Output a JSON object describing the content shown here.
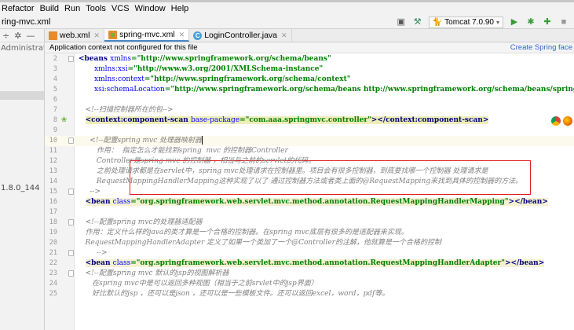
{
  "menu": [
    "Refactor",
    "Build",
    "Run",
    "Tools",
    "VCS",
    "Window",
    "Help"
  ],
  "breadcrumb": "ring-mvc.xml",
  "toolbar": {
    "run_config": "Tomcat 7.0.90"
  },
  "project": {
    "path": "Administrator\\Ic",
    "jdk": "1.8.0_144"
  },
  "tabs": [
    {
      "label": "web.xml",
      "icon": "xml-file-icon"
    },
    {
      "label": "spring-mvc.xml",
      "icon": "spring-xml-icon",
      "active": true
    },
    {
      "label": "LoginController.java",
      "icon": "java-class-icon"
    }
  ],
  "notification": {
    "message": "Application context not configured for this file",
    "action": "Create Spring face"
  },
  "editor": {
    "lines": [
      {
        "n": "2",
        "seg": [
          [
            "<beans ",
            "tag"
          ],
          [
            "xmlns",
            "attr"
          ],
          [
            "=\"http://www.springframework.org/schema/beans\"",
            "val"
          ]
        ]
      },
      {
        "n": "3",
        "seg": [
          [
            "       xmlns:xsi",
            "attr"
          ],
          [
            "=\"http://www.w3.org/2001/XMLSchema-instance\"",
            "val"
          ]
        ]
      },
      {
        "n": "4",
        "seg": [
          [
            "       xmlns:context",
            "attr"
          ],
          [
            "=\"http://www.springframework.org/schema/context\"",
            "val"
          ]
        ]
      },
      {
        "n": "5",
        "seg": [
          [
            "       xsi:schemaLocation",
            "attr"
          ],
          [
            "=\"http://www.springframework.org/schema/beans http://www.springframework.org/schema/beans/spring-beans.xs",
            "val"
          ]
        ]
      },
      {
        "n": "6",
        "seg": []
      },
      {
        "n": "7",
        "seg": [
          [
            "   <!--扫描控制器所在的包-->",
            "cmt"
          ]
        ]
      },
      {
        "n": "8",
        "seg": [
          [
            "   ",
            ""
          ],
          [
            "<context:component-scan ",
            "tag bgy"
          ],
          [
            "base-package",
            "attr bgy"
          ],
          [
            "=\"com.aaa.springmvc.controller\"",
            "val bgy"
          ],
          [
            "></context:component-scan>",
            "tag bgy"
          ]
        ]
      },
      {
        "n": "9",
        "seg": []
      },
      {
        "n": "10",
        "seg": [
          [
            "     <!--配置spring mvc 处理器映射器",
            "cmt"
          ]
        ]
      },
      {
        "n": "11",
        "seg": [
          [
            "        作用：  指定怎么才能找到spring  mvc 的控制器Controller",
            "cmt"
          ]
        ]
      },
      {
        "n": "12",
        "seg": [
          [
            "        Controller是spring mvc 的控制器 ，相当与之前的servlet的代码。",
            "cmt"
          ]
        ]
      },
      {
        "n": "13",
        "seg": [
          [
            "        之前处理请求都是在servlet中，spring mvc处理请求在控制器里。项目会有很多控制器，到底要找哪一个控制器 处理请求是",
            "cmt"
          ]
        ]
      },
      {
        "n": "14",
        "seg": [
          [
            "        RequestMappingHandlerMapping这种实现了以了 通过控制器方法或者类上面的@RequestMapping来找到具体的控制器的方法。",
            "cmt"
          ]
        ]
      },
      {
        "n": "15",
        "seg": [
          [
            "     -->",
            "cmt"
          ]
        ]
      },
      {
        "n": "16",
        "seg": [
          [
            "   ",
            ""
          ],
          [
            "<bean ",
            "tag hl"
          ],
          [
            "class",
            "attr hl"
          ],
          [
            "=\"org.springframework.web.servlet.mvc.method.annotation.RequestMappingHandlerMapping\"",
            "val hl"
          ],
          [
            "></bean>",
            "tag hl"
          ]
        ]
      },
      {
        "n": "17",
        "seg": []
      },
      {
        "n": "18",
        "seg": [
          [
            "   <!--配置spring mvc的处理器适配器",
            "cmt"
          ]
        ]
      },
      {
        "n": "19",
        "seg": [
          [
            "   作用：定义什么样的java的类才算是一个合格的控制器。在spring mvc底层有很多的是适配器来实现。",
            "cmt"
          ]
        ]
      },
      {
        "n": "20",
        "seg": [
          [
            "   RequestMappingHandlerAdapter 定义了如果一个类加了一个@Controller的注解，他就算是一个合格的控制",
            "cmt"
          ]
        ]
      },
      {
        "n": "21",
        "seg": [
          [
            "        -->",
            "cmt"
          ]
        ]
      },
      {
        "n": "22",
        "seg": [
          [
            "   ",
            ""
          ],
          [
            "<bean ",
            "tag hl"
          ],
          [
            "class",
            "attr hl"
          ],
          [
            "=\"org.springframework.web.servlet.mvc.method.annotation.RequestMappingHandlerAdapter\"",
            "val hl"
          ],
          [
            "></bean>",
            "tag hl"
          ]
        ]
      },
      {
        "n": "23",
        "seg": [
          [
            "   <!--配置spring mvc 默认的jsp的视图解析器",
            "cmt"
          ]
        ]
      },
      {
        "n": "24",
        "seg": [
          [
            "      在spring mvc中是可以返回多种视图（相当于之前srvlet中的jsp界面）",
            "cmt"
          ]
        ]
      },
      {
        "n": "25",
        "seg": [
          [
            "      好比默认的jsp ，还可以是json ，还可以是一些模板文件。还可以返回excel，word，pdf等。",
            "cmt"
          ]
        ]
      }
    ]
  },
  "colors": {
    "tag": "#000080",
    "attribute": "#0000ff",
    "value": "#008000",
    "comment": "#808080",
    "annotation_box": "#e02020",
    "tab_underline": "#4a88c7",
    "link": "#2d6bc2"
  }
}
